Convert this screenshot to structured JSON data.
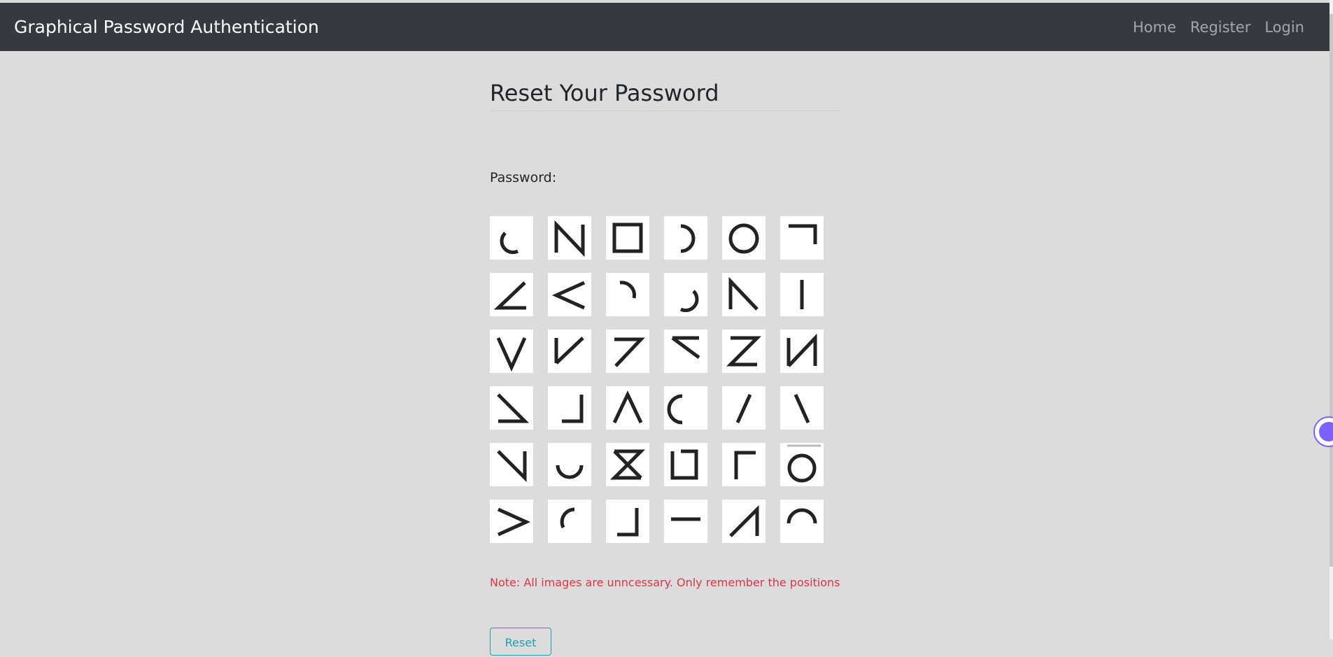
{
  "navbar": {
    "brand": "Graphical Password Authentication",
    "links": [
      "Home",
      "Register",
      "Login"
    ]
  },
  "page": {
    "title": "Reset Your Password",
    "password_label": "Password:",
    "note": "Note: All images are unncessary. Only remember the positions",
    "submit_label": "Reset"
  },
  "grid": {
    "rows": 6,
    "cols": 6,
    "glyphs": [
      [
        "arc-lower-left",
        "letter-n",
        "square",
        "arc-right",
        "circle",
        "corner-top-right"
      ],
      [
        "angle",
        "less-than",
        "arc-top-right",
        "arc-bottom-right",
        "diag-left-peak",
        "vertical-line"
      ],
      [
        "letter-v",
        "check-v",
        "seven",
        "reverse-seven",
        "letter-z",
        "letter-n-reverse"
      ],
      [
        "slash-bottom",
        "corner-bottom-right",
        "caret",
        "arc-left",
        "slash",
        "backslash"
      ],
      [
        "diag-corner",
        "arc-bottom",
        "letter-z-reverse",
        "bracket-box",
        "corner-top-left",
        "circle-open"
      ],
      [
        "greater-than",
        "arc-top-left",
        "corner-bottom-right-tall",
        "horizontal-line",
        "diag-up",
        "arc-top"
      ]
    ]
  },
  "colors": {
    "navbar_bg": "#343a40",
    "page_bg": "#dcdcdc",
    "note_text": "#dc3545",
    "button_outline": "#17a2b8"
  }
}
